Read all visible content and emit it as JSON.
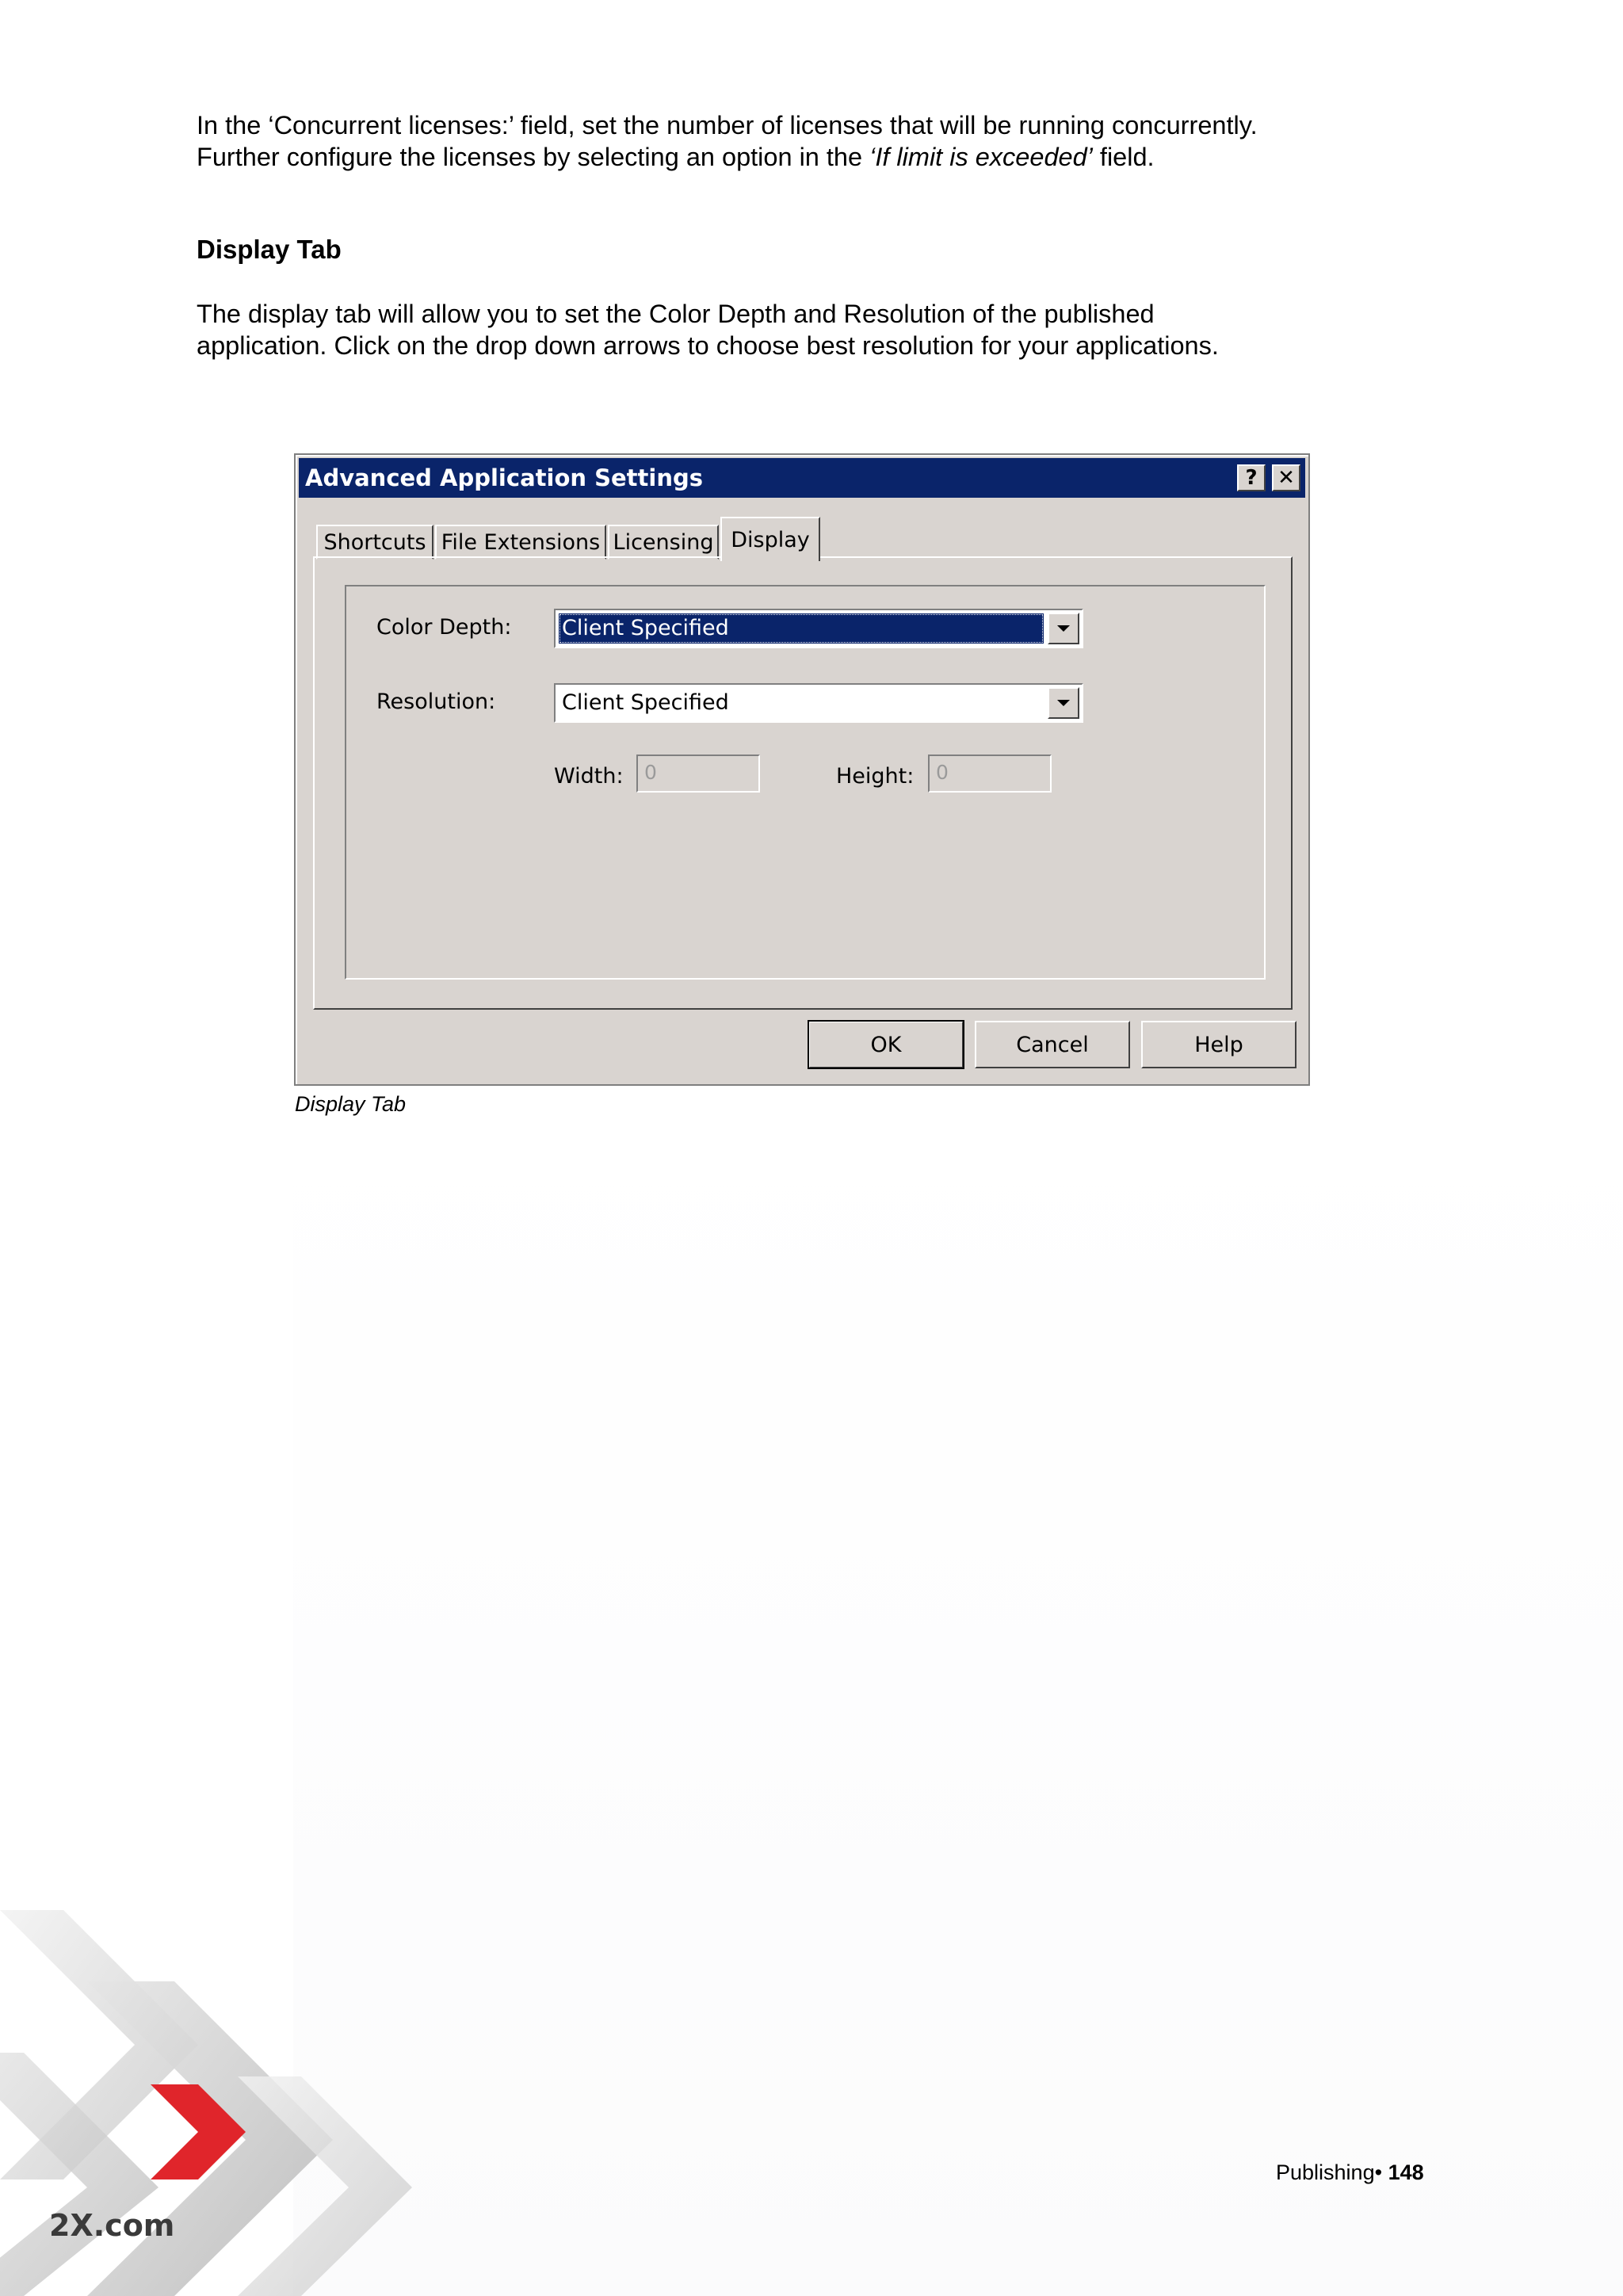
{
  "intro": {
    "line1": "In the ‘Concurrent licenses:’ field, set the number of licenses that will be running concurrently.",
    "line2_prefix": "Further configure the licenses by selecting an option in the ",
    "line2_italic": "‘If limit is exceeded’",
    "line2_suffix": " field."
  },
  "section": {
    "heading": "Display Tab",
    "line1": "The display tab will allow you to set the Color Depth and Resolution of the published",
    "line2": "application.  Click on the drop down arrows to choose best resolution for your applications."
  },
  "dialog": {
    "title": "Advanced Application Settings",
    "help_glyph": "?",
    "close_glyph": "✕",
    "tabs": [
      "Shortcuts",
      "File Extensions",
      "Licensing",
      "Display"
    ],
    "active_tab": "Display",
    "color_depth_label": "Color Depth:",
    "color_depth_value": "Client Specified",
    "resolution_label": "Resolution:",
    "resolution_value": "Client Specified",
    "width_label": "Width:",
    "width_value": "0",
    "height_label": "Height:",
    "height_value": "0",
    "ok_label": "OK",
    "cancel_label": "Cancel",
    "help_label": "Help"
  },
  "caption": "Display Tab",
  "footer": {
    "section": "Publishing",
    "bullet": "•",
    "page": "148"
  },
  "logo": {
    "text": "2X.com",
    "accent_color": "#e0252b"
  }
}
